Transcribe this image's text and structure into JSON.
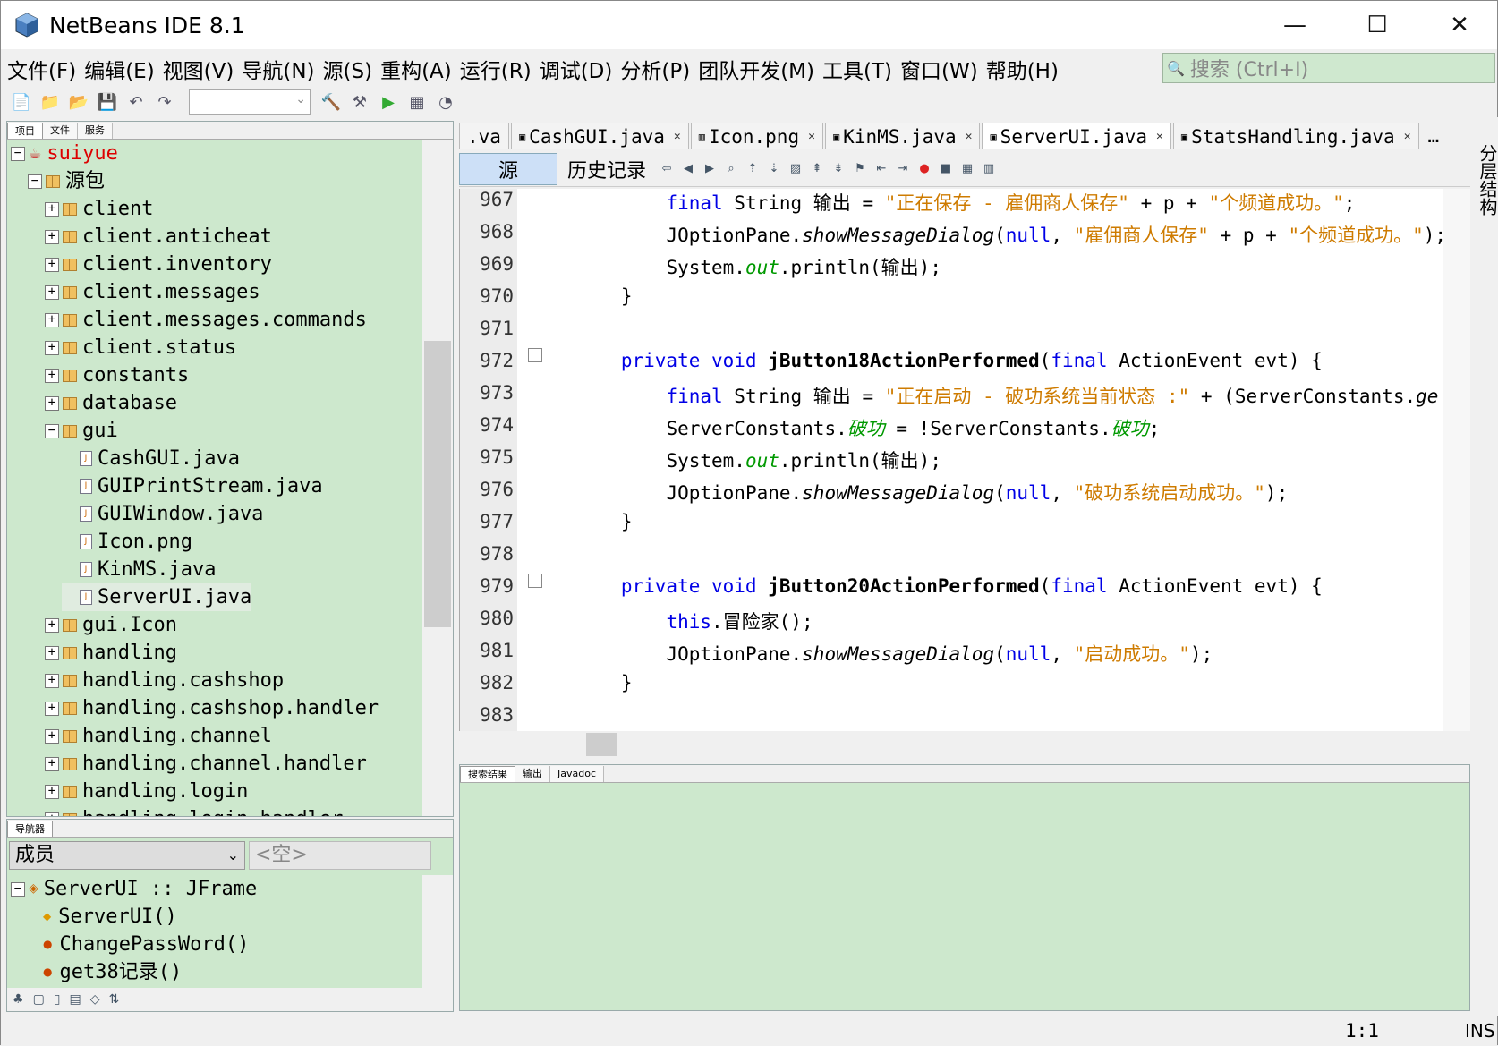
{
  "window": {
    "title": "NetBeans IDE 8.1",
    "minimize": "—",
    "maximize": "☐",
    "close": "✕"
  },
  "menubar": [
    "文件(F)",
    "编辑(E)",
    "视图(V)",
    "导航(N)",
    "源(S)",
    "重构(A)",
    "运行(R)",
    "调试(D)",
    "分析(P)",
    "团队开发(M)",
    "工具(T)",
    "窗口(W)",
    "帮助(H)"
  ],
  "search": {
    "placeholder": "搜索 (Ctrl+I)"
  },
  "project_panel": {
    "tabs": [
      "项目",
      "文件",
      "服务"
    ],
    "tree": [
      {
        "label": "suiyue",
        "level": 0,
        "kind": "project",
        "exp": "−"
      },
      {
        "label": "源包",
        "level": 1,
        "kind": "folder",
        "exp": "−"
      },
      {
        "label": "client",
        "level": 2,
        "kind": "pkg",
        "exp": "+"
      },
      {
        "label": "client.anticheat",
        "level": 2,
        "kind": "pkg",
        "exp": "+"
      },
      {
        "label": "client.inventory",
        "level": 2,
        "kind": "pkg",
        "exp": "+"
      },
      {
        "label": "client.messages",
        "level": 2,
        "kind": "pkg",
        "exp": "+"
      },
      {
        "label": "client.messages.commands",
        "level": 2,
        "kind": "pkg",
        "exp": "+"
      },
      {
        "label": "client.status",
        "level": 2,
        "kind": "pkg",
        "exp": "+"
      },
      {
        "label": "constants",
        "level": 2,
        "kind": "pkg",
        "exp": "+"
      },
      {
        "label": "database",
        "level": 2,
        "kind": "pkg",
        "exp": "+"
      },
      {
        "label": "gui",
        "level": 2,
        "kind": "pkg",
        "exp": "−"
      },
      {
        "label": "CashGUI.java",
        "level": 3,
        "kind": "file"
      },
      {
        "label": "GUIPrintStream.java",
        "level": 3,
        "kind": "file"
      },
      {
        "label": "GUIWindow.java",
        "level": 3,
        "kind": "file"
      },
      {
        "label": "Icon.png",
        "level": 3,
        "kind": "file"
      },
      {
        "label": "KinMS.java",
        "level": 3,
        "kind": "file"
      },
      {
        "label": "ServerUI.java",
        "level": 3,
        "kind": "file"
      },
      {
        "label": "gui.Icon",
        "level": 2,
        "kind": "pkg",
        "exp": "+"
      },
      {
        "label": "handling",
        "level": 2,
        "kind": "pkg",
        "exp": "+"
      },
      {
        "label": "handling.cashshop",
        "level": 2,
        "kind": "pkg",
        "exp": "+"
      },
      {
        "label": "handling.cashshop.handler",
        "level": 2,
        "kind": "pkg",
        "exp": "+"
      },
      {
        "label": "handling.channel",
        "level": 2,
        "kind": "pkg",
        "exp": "+"
      },
      {
        "label": "handling.channel.handler",
        "level": 2,
        "kind": "pkg",
        "exp": "+"
      },
      {
        "label": "handling.login",
        "level": 2,
        "kind": "pkg",
        "exp": "+"
      },
      {
        "label": "handling.login.handler",
        "level": 2,
        "kind": "pkg",
        "exp": "+"
      }
    ]
  },
  "navigator": {
    "tab": "导航器",
    "filter": "成员",
    "secondary": "<空>",
    "items": [
      "ServerUI :: JFrame",
      "ServerUI()",
      "ChangePassWord()",
      "get38记录()"
    ]
  },
  "editor_tabs": [
    ".va",
    "CashGUI.java",
    "Icon.png",
    "KinMS.java",
    "ServerUI.java",
    "StatsHandling.java"
  ],
  "editor_toolbar": {
    "source": "源",
    "history": "历史记录"
  },
  "code": {
    "line_numbers": [
      "967",
      "968",
      "969",
      "970",
      "971",
      "972",
      "973",
      "974",
      "975",
      "976",
      "977",
      "978",
      "979",
      "980",
      "981",
      "982",
      "983"
    ]
  },
  "output_panel": {
    "tabs": [
      "搜索结果",
      "输出",
      "Javadoc"
    ]
  },
  "right_sidebar": "分层结构",
  "status": {
    "position": "1:1",
    "mode": "INS"
  }
}
